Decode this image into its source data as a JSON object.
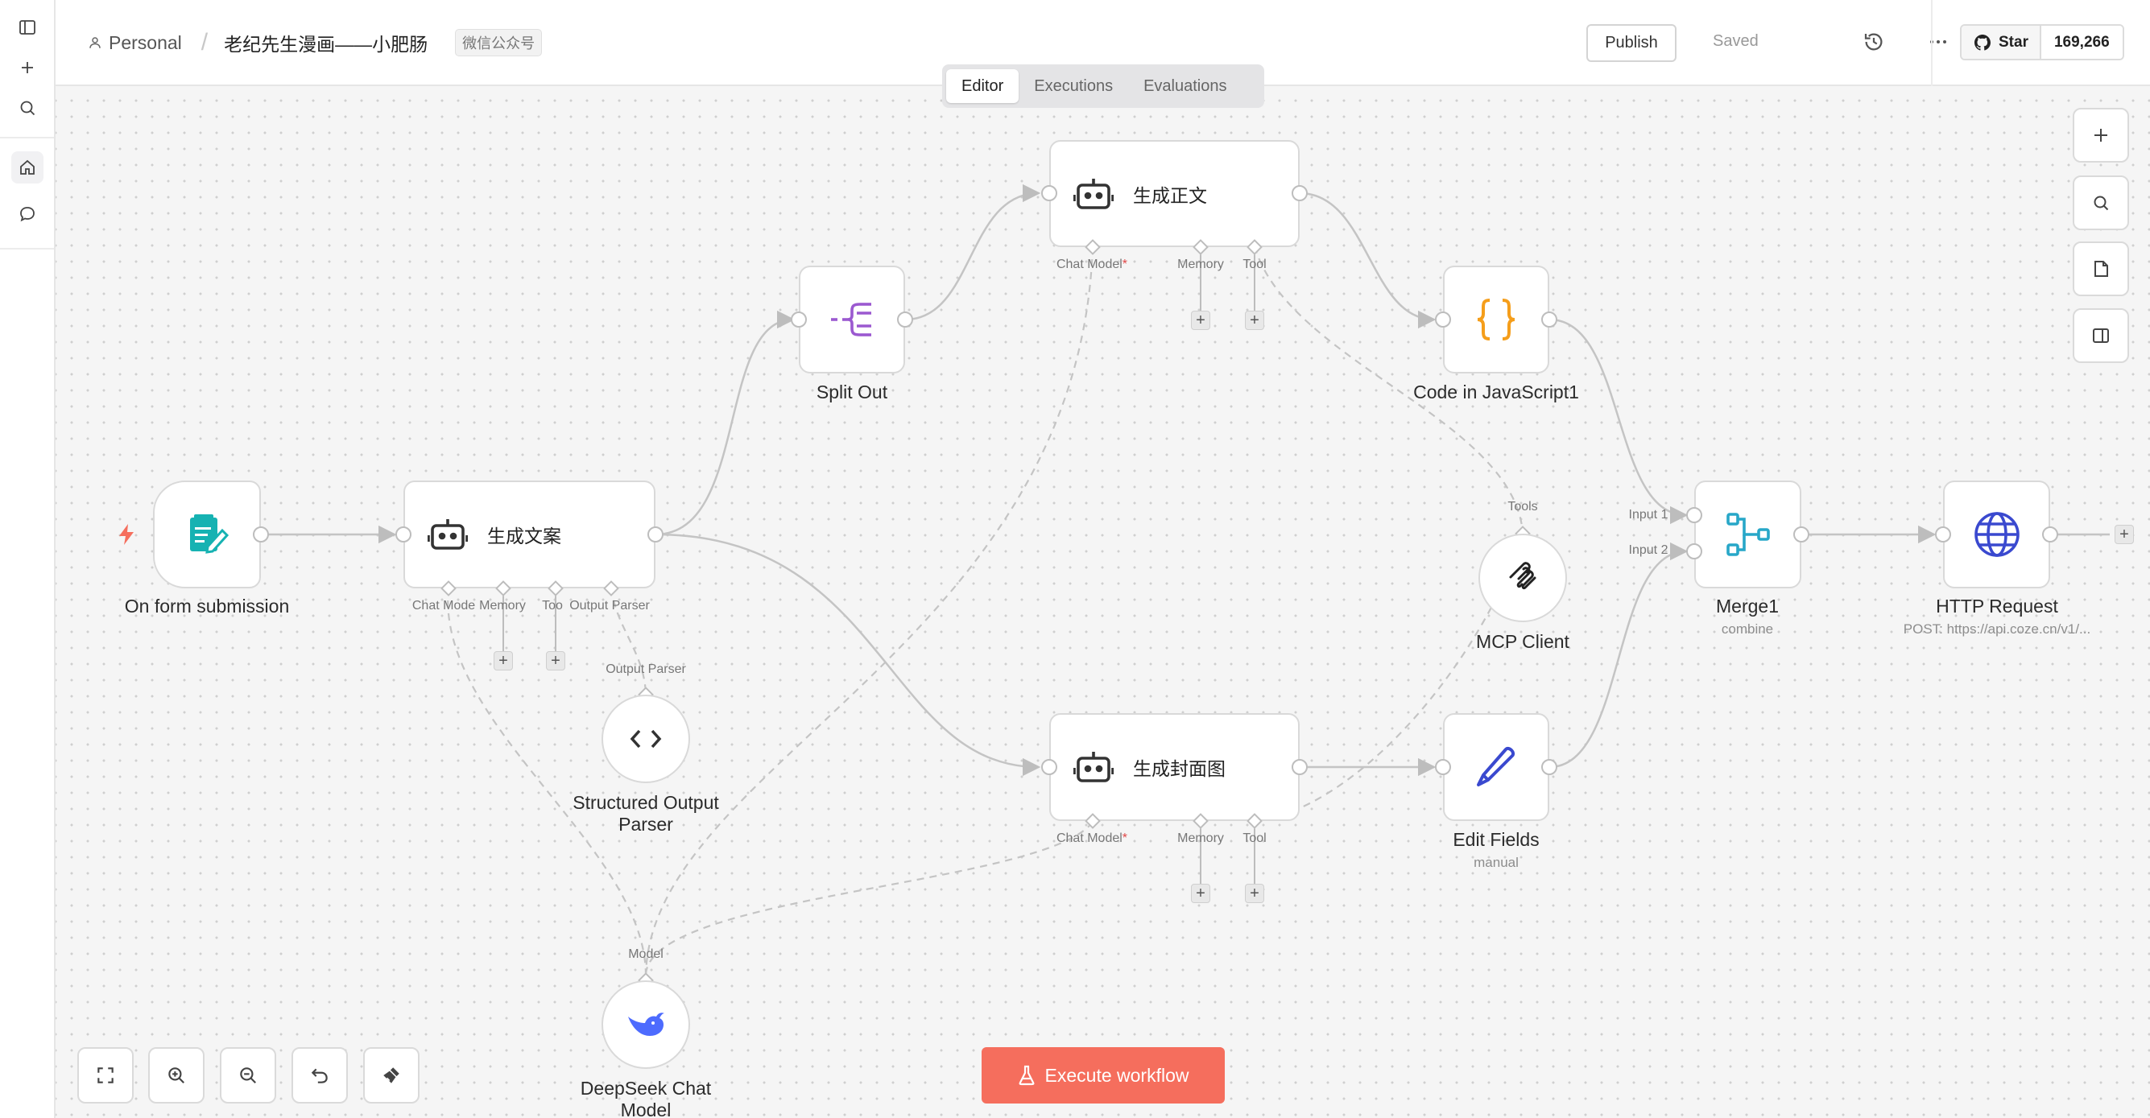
{
  "header": {
    "project": "Personal",
    "workflow_name": "老纪先生漫画——小肥肠",
    "tag": "微信公众号",
    "publish_label": "Publish",
    "saved_label": "Saved",
    "star_label": "Star",
    "star_count": "169,266"
  },
  "tabs": [
    {
      "label": "Editor",
      "active": true
    },
    {
      "label": "Executions",
      "active": false
    },
    {
      "label": "Evaluations",
      "active": false
    }
  ],
  "nodes": {
    "form": {
      "label": "On form submission",
      "icon": "form-icon"
    },
    "agent1": {
      "title": "生成文案",
      "icon": "robot-icon"
    },
    "split": {
      "label": "Split Out",
      "icon": "split-icon"
    },
    "agent2": {
      "title": "生成正文",
      "icon": "robot-icon"
    },
    "code": {
      "label": "Code in JavaScript1",
      "icon": "braces-icon"
    },
    "mcp": {
      "label": "MCP Client",
      "icon": "mcp-icon"
    },
    "merge": {
      "label": "Merge1",
      "sub": "combine",
      "icon": "merge-icon"
    },
    "http": {
      "label": "HTTP Request",
      "sub": "POST: https://api.coze.cn/v1/...",
      "icon": "globe-icon"
    },
    "parser": {
      "label1": "Structured Output",
      "label2": "Parser",
      "icon": "code-brackets-icon"
    },
    "agent3": {
      "title": "生成封面图",
      "icon": "robot-icon"
    },
    "edit": {
      "label": "Edit Fields",
      "sub": "manual",
      "icon": "pen-icon"
    },
    "deepseek": {
      "label1": "DeepSeek Chat",
      "label2": "Model",
      "icon": "deepseek-whale-icon"
    }
  },
  "ports": {
    "chat_model": "Chat Model",
    "chat_model_short": "Chat Mode",
    "memory": "Memory",
    "tool": "Tool",
    "tool_short": "Too",
    "output_parser": "Output Parser",
    "model": "Model",
    "tools": "Tools",
    "input1": "Input 1",
    "input2": "Input 2",
    "required_mark": "*"
  },
  "footer": {
    "execute_label": "Execute workflow"
  },
  "colors": {
    "accent": "#f56e5d",
    "form_icon": "#16b2b2",
    "split_icon": "#9b59d0",
    "code_icon": "#f59e1b",
    "merge_icon": "#27a7c8",
    "http_icon": "#3a49cf",
    "edit_icon": "#3a49cf",
    "deepseek_icon": "#4d6bfe"
  }
}
